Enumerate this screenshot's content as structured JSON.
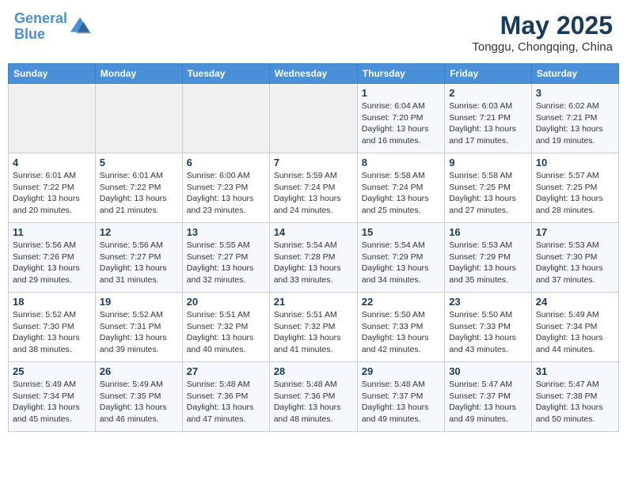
{
  "header": {
    "logo_line1": "General",
    "logo_line2": "Blue",
    "month": "May 2025",
    "location": "Tonggu, Chongqing, China"
  },
  "weekdays": [
    "Sunday",
    "Monday",
    "Tuesday",
    "Wednesday",
    "Thursday",
    "Friday",
    "Saturday"
  ],
  "weeks": [
    [
      {
        "day": "",
        "info": ""
      },
      {
        "day": "",
        "info": ""
      },
      {
        "day": "",
        "info": ""
      },
      {
        "day": "",
        "info": ""
      },
      {
        "day": "1",
        "info": "Sunrise: 6:04 AM\nSunset: 7:20 PM\nDaylight: 13 hours\nand 16 minutes."
      },
      {
        "day": "2",
        "info": "Sunrise: 6:03 AM\nSunset: 7:21 PM\nDaylight: 13 hours\nand 17 minutes."
      },
      {
        "day": "3",
        "info": "Sunrise: 6:02 AM\nSunset: 7:21 PM\nDaylight: 13 hours\nand 19 minutes."
      }
    ],
    [
      {
        "day": "4",
        "info": "Sunrise: 6:01 AM\nSunset: 7:22 PM\nDaylight: 13 hours\nand 20 minutes."
      },
      {
        "day": "5",
        "info": "Sunrise: 6:01 AM\nSunset: 7:22 PM\nDaylight: 13 hours\nand 21 minutes."
      },
      {
        "day": "6",
        "info": "Sunrise: 6:00 AM\nSunset: 7:23 PM\nDaylight: 13 hours\nand 23 minutes."
      },
      {
        "day": "7",
        "info": "Sunrise: 5:59 AM\nSunset: 7:24 PM\nDaylight: 13 hours\nand 24 minutes."
      },
      {
        "day": "8",
        "info": "Sunrise: 5:58 AM\nSunset: 7:24 PM\nDaylight: 13 hours\nand 25 minutes."
      },
      {
        "day": "9",
        "info": "Sunrise: 5:58 AM\nSunset: 7:25 PM\nDaylight: 13 hours\nand 27 minutes."
      },
      {
        "day": "10",
        "info": "Sunrise: 5:57 AM\nSunset: 7:25 PM\nDaylight: 13 hours\nand 28 minutes."
      }
    ],
    [
      {
        "day": "11",
        "info": "Sunrise: 5:56 AM\nSunset: 7:26 PM\nDaylight: 13 hours\nand 29 minutes."
      },
      {
        "day": "12",
        "info": "Sunrise: 5:56 AM\nSunset: 7:27 PM\nDaylight: 13 hours\nand 31 minutes."
      },
      {
        "day": "13",
        "info": "Sunrise: 5:55 AM\nSunset: 7:27 PM\nDaylight: 13 hours\nand 32 minutes."
      },
      {
        "day": "14",
        "info": "Sunrise: 5:54 AM\nSunset: 7:28 PM\nDaylight: 13 hours\nand 33 minutes."
      },
      {
        "day": "15",
        "info": "Sunrise: 5:54 AM\nSunset: 7:29 PM\nDaylight: 13 hours\nand 34 minutes."
      },
      {
        "day": "16",
        "info": "Sunrise: 5:53 AM\nSunset: 7:29 PM\nDaylight: 13 hours\nand 35 minutes."
      },
      {
        "day": "17",
        "info": "Sunrise: 5:53 AM\nSunset: 7:30 PM\nDaylight: 13 hours\nand 37 minutes."
      }
    ],
    [
      {
        "day": "18",
        "info": "Sunrise: 5:52 AM\nSunset: 7:30 PM\nDaylight: 13 hours\nand 38 minutes."
      },
      {
        "day": "19",
        "info": "Sunrise: 5:52 AM\nSunset: 7:31 PM\nDaylight: 13 hours\nand 39 minutes."
      },
      {
        "day": "20",
        "info": "Sunrise: 5:51 AM\nSunset: 7:32 PM\nDaylight: 13 hours\nand 40 minutes."
      },
      {
        "day": "21",
        "info": "Sunrise: 5:51 AM\nSunset: 7:32 PM\nDaylight: 13 hours\nand 41 minutes."
      },
      {
        "day": "22",
        "info": "Sunrise: 5:50 AM\nSunset: 7:33 PM\nDaylight: 13 hours\nand 42 minutes."
      },
      {
        "day": "23",
        "info": "Sunrise: 5:50 AM\nSunset: 7:33 PM\nDaylight: 13 hours\nand 43 minutes."
      },
      {
        "day": "24",
        "info": "Sunrise: 5:49 AM\nSunset: 7:34 PM\nDaylight: 13 hours\nand 44 minutes."
      }
    ],
    [
      {
        "day": "25",
        "info": "Sunrise: 5:49 AM\nSunset: 7:34 PM\nDaylight: 13 hours\nand 45 minutes."
      },
      {
        "day": "26",
        "info": "Sunrise: 5:49 AM\nSunset: 7:35 PM\nDaylight: 13 hours\nand 46 minutes."
      },
      {
        "day": "27",
        "info": "Sunrise: 5:48 AM\nSunset: 7:36 PM\nDaylight: 13 hours\nand 47 minutes."
      },
      {
        "day": "28",
        "info": "Sunrise: 5:48 AM\nSunset: 7:36 PM\nDaylight: 13 hours\nand 48 minutes."
      },
      {
        "day": "29",
        "info": "Sunrise: 5:48 AM\nSunset: 7:37 PM\nDaylight: 13 hours\nand 49 minutes."
      },
      {
        "day": "30",
        "info": "Sunrise: 5:47 AM\nSunset: 7:37 PM\nDaylight: 13 hours\nand 49 minutes."
      },
      {
        "day": "31",
        "info": "Sunrise: 5:47 AM\nSunset: 7:38 PM\nDaylight: 13 hours\nand 50 minutes."
      }
    ]
  ]
}
